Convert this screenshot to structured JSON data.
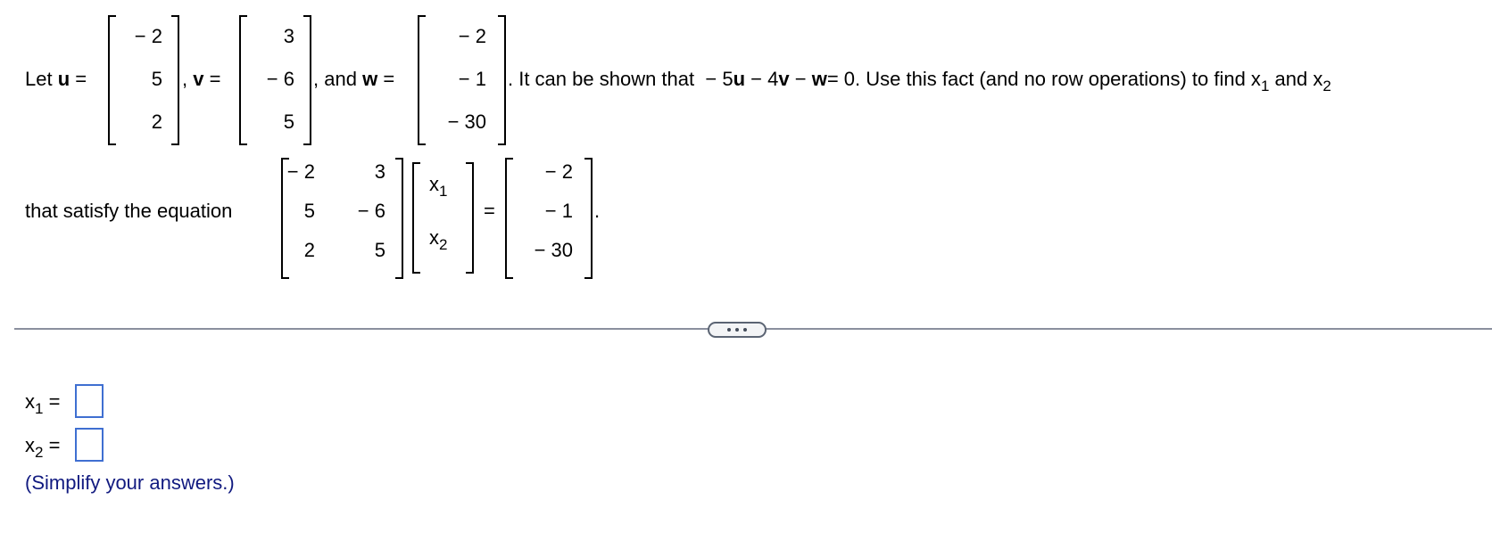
{
  "problem": {
    "intro": "Let",
    "vectors": {
      "u": {
        "name": "u",
        "values": [
          "− 2",
          "5",
          "2"
        ]
      },
      "v": {
        "name": "v",
        "values": [
          "3",
          "− 6",
          "5"
        ]
      },
      "w": {
        "name": "w",
        "values": [
          "− 2",
          "− 1",
          "− 30"
        ]
      }
    },
    "equals": "=",
    "comma": ",",
    "and_text": ", and",
    "statement_pre": ". It can be shown that",
    "relation": {
      "t1_coef": "− 5",
      "t1_var": "u",
      "t2_coef": "− 4",
      "t2_var": "v",
      "t3_coef": "−",
      "t3_var": "w",
      "rhs": "= 0"
    },
    "statement_post": ". Use this fact (and no row operations) to find x",
    "find_sub1": "1",
    "find_and": "and x",
    "find_sub2": "2",
    "equation_lead": "that satisfy the equation",
    "matrix_A": [
      [
        "− 2",
        "3"
      ],
      [
        "5",
        "− 6"
      ],
      [
        "2",
        "5"
      ]
    ],
    "unknowns": [
      {
        "base": "x",
        "sub": "1"
      },
      {
        "base": "x",
        "sub": "2"
      }
    ],
    "rhs_vector": [
      "− 2",
      "− 1",
      "− 30"
    ],
    "period": "."
  },
  "expand_button": {
    "icon": "ellipsis-icon"
  },
  "answers": {
    "x1": {
      "base": "x",
      "sub": "1",
      "equals": "=",
      "value": ""
    },
    "x2": {
      "base": "x",
      "sub": "2",
      "equals": "=",
      "value": ""
    },
    "hint": "(Simplify your answers.)"
  }
}
